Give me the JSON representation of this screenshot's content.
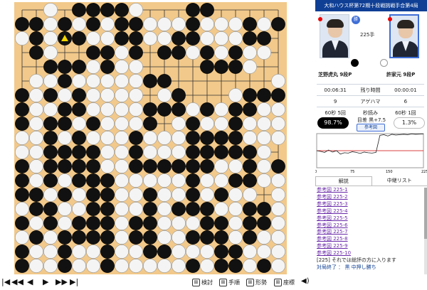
{
  "game_title": "大和ハウス杯第72期十段戦挑戦手合第4局",
  "move_label": "225手",
  "players": {
    "black": {
      "name": "芝野虎丸 9段P",
      "color": "黒"
    },
    "white": {
      "name": "許家元 9段P",
      "color": "白"
    }
  },
  "winner_badge": "勝",
  "clock": {
    "black_time": "00:06:31",
    "label_time": "残り時間",
    "white_time": "00:00:01",
    "black_captures": "9",
    "label_captures": "アゲハマ",
    "white_captures": "6",
    "black_byoyomi": "60秒 5回",
    "label_byoyomi": "秒読み",
    "white_byoyomi": "60秒 1回"
  },
  "win_rate": {
    "black": "98.7%",
    "white": "1.3%",
    "margin_label": "目差 黒+7.5",
    "ref_button": "参考図"
  },
  "graph": {
    "x_labels": [
      "0",
      "75",
      "150",
      "225"
    ],
    "black_rate_series": [
      0.5,
      0.48,
      0.45,
      0.52,
      0.46,
      0.5,
      0.4,
      0.44,
      0.43,
      0.47,
      0.45,
      0.42,
      0.46,
      0.44,
      0.43,
      0.45,
      0.95,
      0.97,
      0.93,
      0.98,
      0.96,
      0.97,
      0.98,
      0.97,
      0.99,
      0.98,
      0.985,
      0.99
    ]
  },
  "tabs": [
    "解説",
    "中継リスト"
  ],
  "commentary": {
    "references": [
      "参考図 225-1",
      "参考図 225-2",
      "参考図 225-3",
      "参考図 225-4",
      "参考図 225-5",
      "参考図 225-6",
      "参考図 225-7",
      "参考図 225-8",
      "参考図 225-9",
      "参考図 225-10"
    ],
    "note": "[225] それでは総評の方に入ります",
    "result": "対局終了 ： 黒 中押し勝ち"
  },
  "controls": {
    "nav": [
      "|◀",
      "◀◀",
      "◀",
      "▶",
      "▶▶",
      "▶|"
    ],
    "tools": [
      "検討",
      "手順",
      "形勢",
      "座標"
    ],
    "sound_icon": "speaker-icon"
  },
  "board_rows": [
    "..W.BBBBW...BB.....",
    "BBWBWBWBBWWWBWWWBWB",
    "WBWBBWWBBWWBBWWWBB.",
    ".BW..BBWB.BBWBWBWW.",
    "..BBBWBWW....BBBW..",
    ".WWBWWWWWBB.......W",
    "BWBWBWWWW.WB...WBBB",
    "BWWBBWWWWBBBWBWBBWW",
    "BWBBWBWWWB.WBWWBWWW",
    "WWBWBWWWBWWWBBBBWWW",
    "WWBBBBWWBWWWBBBBBW.",
    "BWBBBBWWBBBBBBWWBWB",
    "BWBWBBBWWWWWBWWBBWW",
    "BBWBWBBWWBWWBWBWW.W",
    "WBBWWBBWWBWBBBWWBBW",
    "BWBWBBBWBBWWWBBWBBW",
    "WBWBBBBWBBWWBBBWBWW",
    "BWWBWWBWWBBWWWBBWWW",
    "BWWBWWBWWWWWBWBBWBW"
  ],
  "last_move": {
    "row": 2,
    "col": 3
  }
}
